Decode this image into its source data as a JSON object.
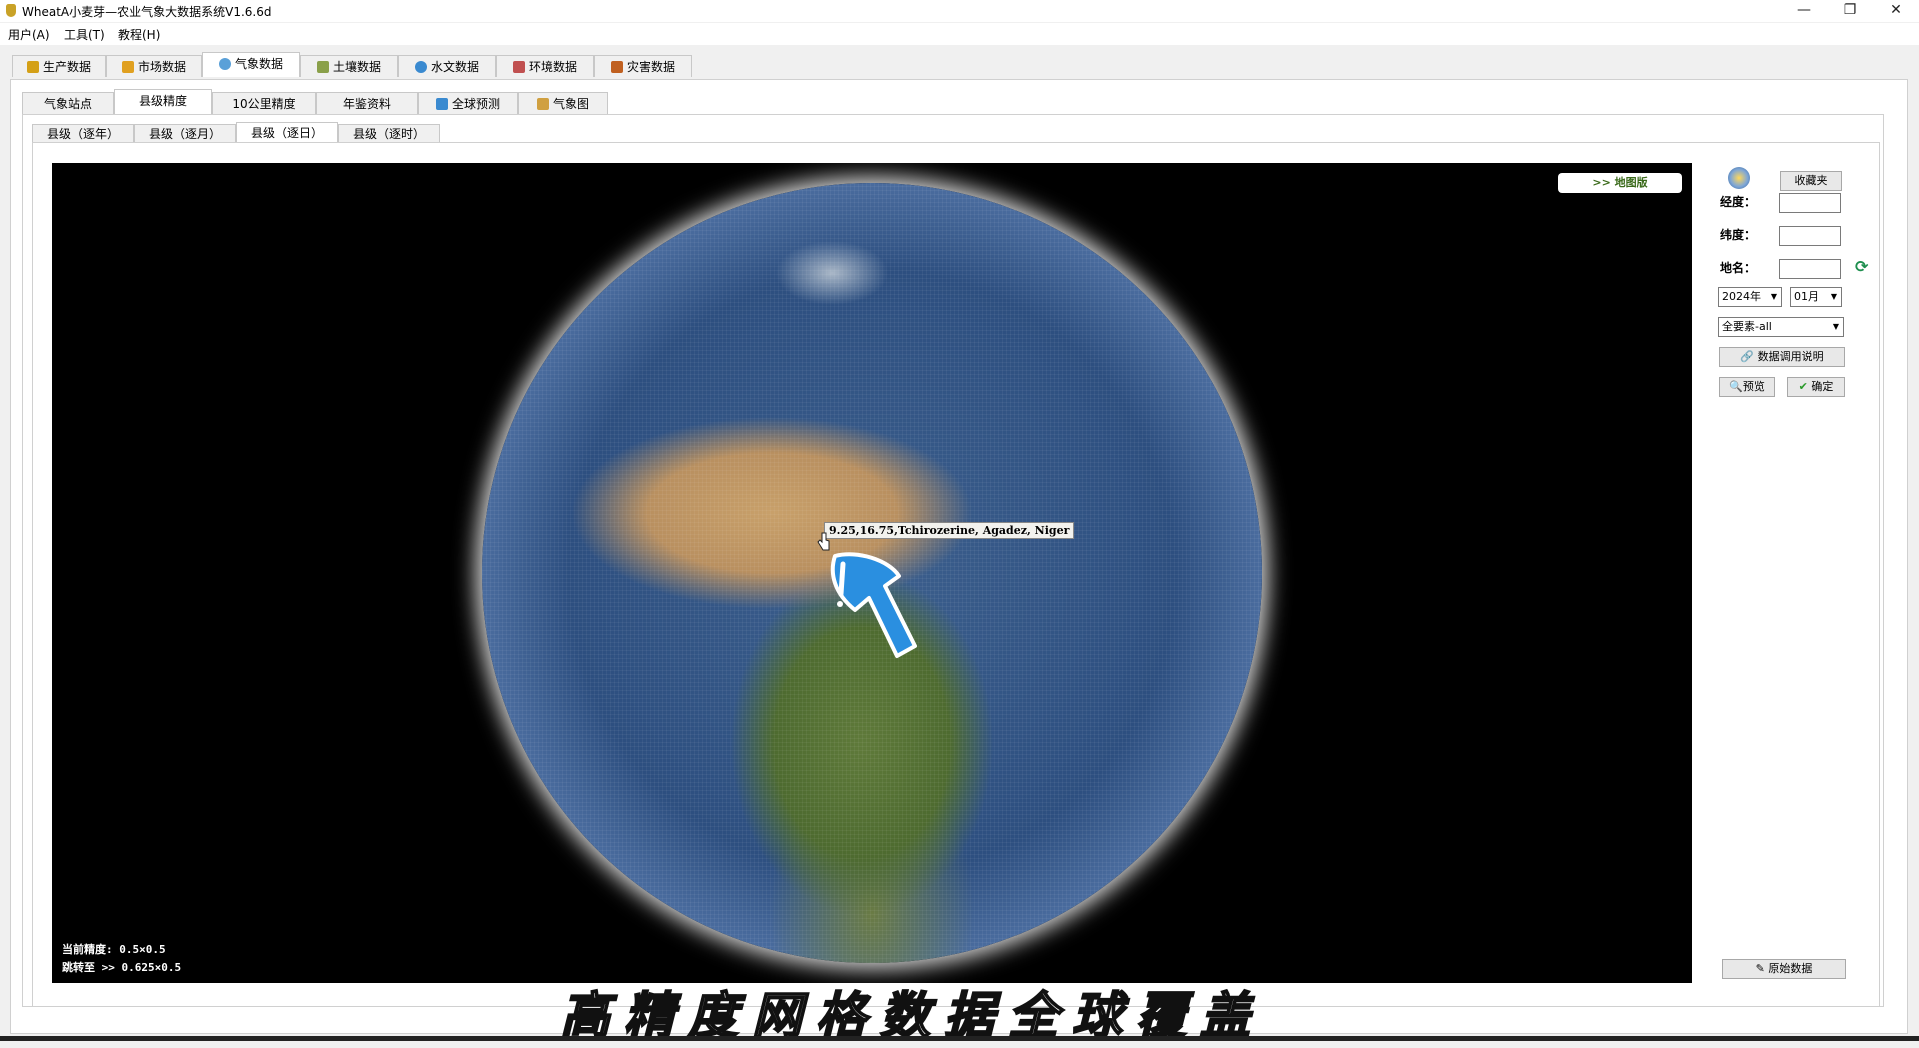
{
  "window": {
    "title": "WheatA小麦芽—农业气象大数据系统V1.6.6d",
    "minimize": "—",
    "restore": "❐",
    "close": "✕"
  },
  "menu": [
    "用户(A)",
    "工具(T)",
    "教程(H)"
  ],
  "main_tabs": [
    {
      "label": "生产数据",
      "icon_color": "#d4a017",
      "icon": "wheat-icon"
    },
    {
      "label": "市场数据",
      "icon_color": "#e0a020",
      "icon": "market-icon"
    },
    {
      "label": "气象数据",
      "icon_color": "#5aa0d8",
      "icon": "cloud-icon"
    },
    {
      "label": "土壤数据",
      "icon_color": "#8aa04a",
      "icon": "soil-icon"
    },
    {
      "label": "水文数据",
      "icon_color": "#3a8ad0",
      "icon": "water-icon"
    },
    {
      "label": "环境数据",
      "icon_color": "#c05050",
      "icon": "car-icon"
    },
    {
      "label": "灾害数据",
      "icon_color": "#c06020",
      "icon": "disaster-icon"
    }
  ],
  "sub_tabs": [
    {
      "label": "气象站点"
    },
    {
      "label": "县级精度"
    },
    {
      "label": "10公里精度"
    },
    {
      "label": "年鉴资料"
    },
    {
      "label": "全球预测",
      "icon_color": "#3a8ad0"
    },
    {
      "label": "气象图",
      "icon_color": "#d0a040"
    }
  ],
  "county_tabs": [
    "县级（逐年）",
    "县级（逐月）",
    "县级（逐日）",
    "县级（逐时）"
  ],
  "map": {
    "mapver_button": ">> 地图版",
    "tooltip": "9.25,16.75,Tchirozerine, Agadez, Niger",
    "accuracy_line1": "当前精度: 0.5×0.5",
    "accuracy_line2": "跳转至 >> 0.625×0.5"
  },
  "side": {
    "favorites": "收藏夹",
    "lon_label": "经度：",
    "lat_label": "纬度：",
    "place_label": "地名：",
    "year": "2024年",
    "month": "01月",
    "element": "全要素-all",
    "data_help": "数据调用说明",
    "preview": "预览",
    "confirm": "确定",
    "raw_data": "原始数据"
  },
  "overlay_caption": "高精度网格数据全球覆盖"
}
